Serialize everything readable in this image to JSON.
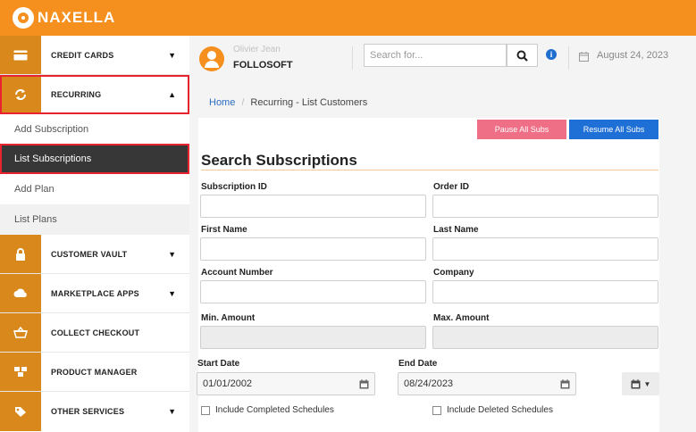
{
  "app": {
    "logo_text": "NAXELLA"
  },
  "sidebar": {
    "credit_cards": "CREDIT CARDS",
    "recurring": "RECURRING",
    "sub_items": [
      "Add Subscription",
      "List Subscriptions",
      "Add Plan",
      "List Plans"
    ],
    "customer_vault": "CUSTOMER VAULT",
    "marketplace_apps": "MARKETPLACE APPS",
    "collect_checkout": "COLLECT CHECKOUT",
    "product_manager": "PRODUCT MANAGER",
    "other_services": "OTHER SERVICES"
  },
  "header": {
    "user_name": "Olivier Jean",
    "company": "FOLLOSOFT",
    "search_placeholder": "Search for...",
    "date": "August 24, 2023"
  },
  "breadcrumb": {
    "home": "Home",
    "current": "Recurring - List Customers"
  },
  "actions": {
    "pause": "Pause All Subs",
    "resume": "Resume All Subs"
  },
  "form": {
    "title": "Search Subscriptions",
    "labels": {
      "subscription_id": "Subscription ID",
      "order_id": "Order ID",
      "first_name": "First Name",
      "last_name": "Last Name",
      "account_number": "Account Number",
      "company": "Company",
      "min_amount": "Min. Amount",
      "max_amount": "Max. Amount",
      "start_date": "Start Date",
      "end_date": "End Date"
    },
    "values": {
      "start_date": "01/01/2002",
      "end_date": "08/24/2023"
    },
    "checkboxes": {
      "completed": "Include Completed Schedules",
      "deleted": "Include Deleted Schedules"
    }
  },
  "colors": {
    "brand": "#f5901f",
    "highlight": "#e8222f",
    "pause": "#ef6f86",
    "resume": "#1e6fd6"
  }
}
